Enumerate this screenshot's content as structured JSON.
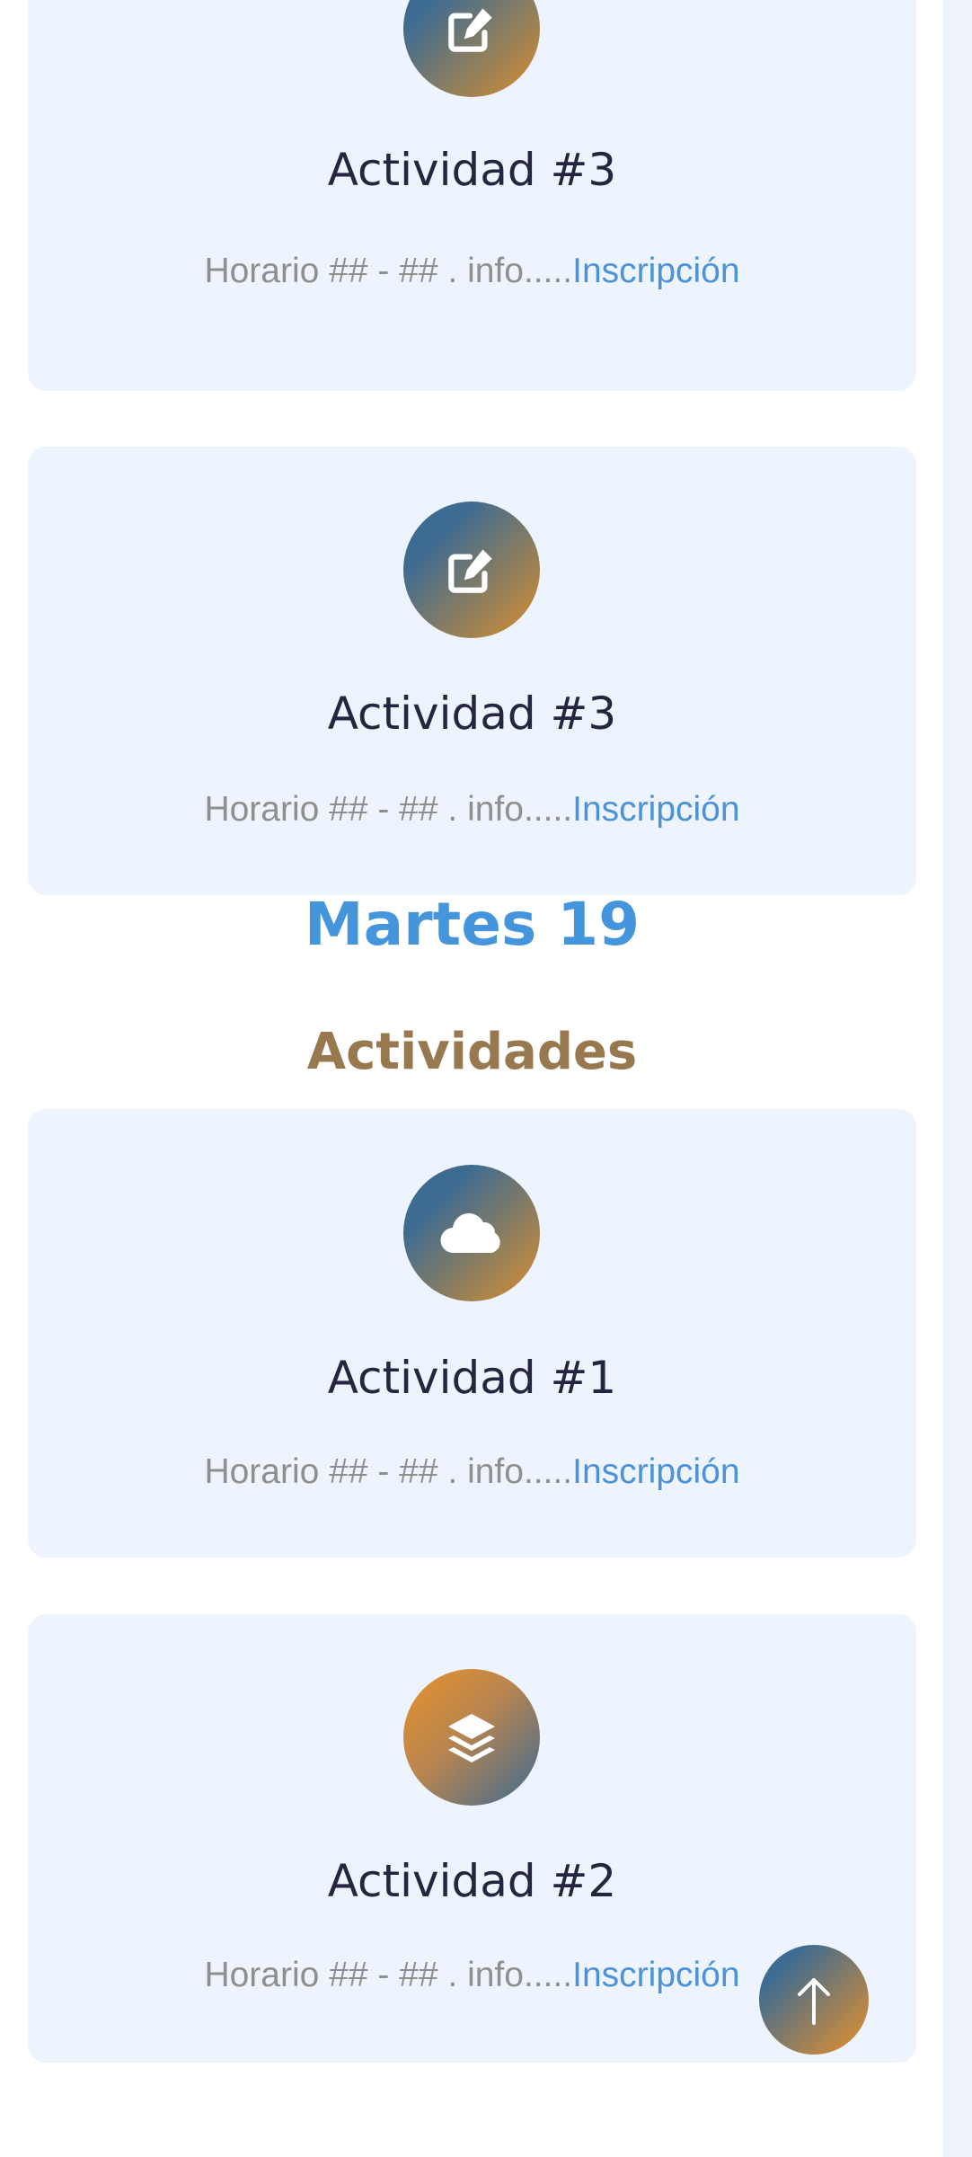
{
  "colors": {
    "card_bg": "#eef4fd",
    "title": "#24253f",
    "body_text": "#8f8f8f",
    "link": "#4c92d8",
    "day_heading": "#4595dc",
    "section_heading": "#98784f",
    "gradient_blue": "#3d6b92",
    "gradient_orange": "#e8912a"
  },
  "cards_top": [
    {
      "icon": "edit-icon",
      "title": "Actividad #3",
      "schedule": "Horario ## - ## . info.....",
      "link": "Inscripción"
    },
    {
      "icon": "edit-icon",
      "title": "Actividad #3",
      "schedule": "Horario ## - ## . info.....",
      "link": "Inscripción"
    }
  ],
  "day": {
    "heading": "Martes 19",
    "section": "Actividades"
  },
  "cards_day": [
    {
      "icon": "cloud-icon",
      "title": "Actividad #1",
      "schedule": "Horario ## - ## . info.....",
      "link": "Inscripción"
    },
    {
      "icon": "layers-icon",
      "title": "Actividad #2",
      "schedule": "Horario ## - ## . info.....",
      "link": "Inscripción"
    }
  ],
  "back_to_top": {
    "icon": "arrow-up-icon"
  }
}
